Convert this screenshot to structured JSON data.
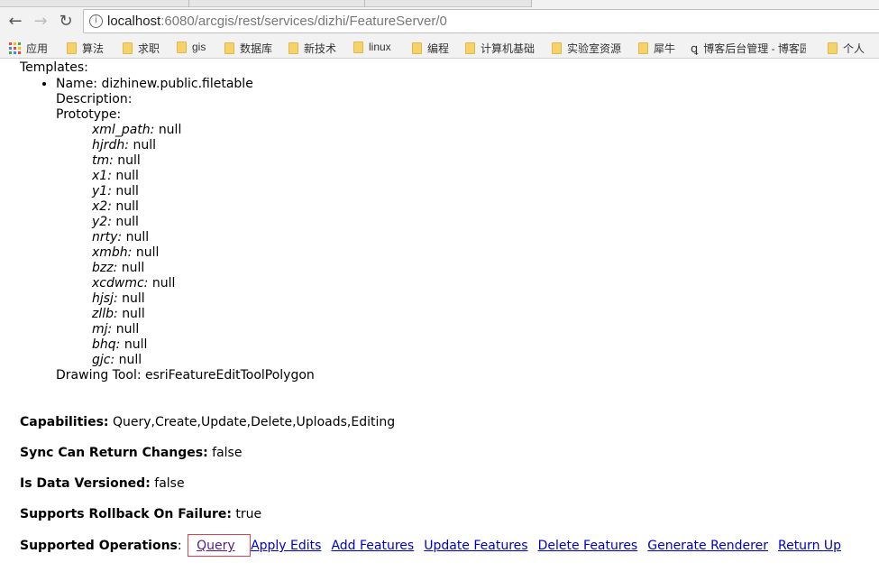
{
  "browser": {
    "url_host": "localhost",
    "url_path": ":6080/arcgis/rest/services/dizhi/FeatureServer/0",
    "bookmarks": [
      "应用",
      "算法",
      "求职",
      "gis",
      "数据库",
      "新技术",
      "linux",
      "编程",
      "计算机基础",
      "实验室资源",
      "犀牛",
      "博客后台管理 - 博客园",
      "个人"
    ]
  },
  "page": {
    "templates_label": "Templates:",
    "template": {
      "name": "Name: dizhinew.public.filetable",
      "description": "Description:",
      "prototype_label": "Prototype:",
      "fields": [
        {
          "k": "xml_path:",
          "v": "null"
        },
        {
          "k": "hjrdh:",
          "v": "null"
        },
        {
          "k": "tm:",
          "v": "null"
        },
        {
          "k": "x1:",
          "v": "null"
        },
        {
          "k": "y1:",
          "v": "null"
        },
        {
          "k": "x2:",
          "v": "null"
        },
        {
          "k": "y2:",
          "v": "null"
        },
        {
          "k": "nrty:",
          "v": "null"
        },
        {
          "k": "xmbh:",
          "v": "null"
        },
        {
          "k": "bzz:",
          "v": "null"
        },
        {
          "k": "xcdwmc:",
          "v": "null"
        },
        {
          "k": "hjsj:",
          "v": "null"
        },
        {
          "k": "zllb:",
          "v": "null"
        },
        {
          "k": "mj:",
          "v": "null"
        },
        {
          "k": "bhq:",
          "v": "null"
        },
        {
          "k": "gjc:",
          "v": "null"
        }
      ],
      "drawing_tool": "Drawing Tool: esriFeatureEditToolPolygon"
    },
    "capabilities": {
      "label": "Capabilities:",
      "value": "Query,Create,Update,Delete,Uploads,Editing"
    },
    "sync": {
      "label": "Sync Can Return Changes:",
      "value": "false"
    },
    "versioned": {
      "label": "Is Data Versioned:",
      "value": "false"
    },
    "rollback": {
      "label": "Supports Rollback On Failure:",
      "value": "true"
    },
    "operations": {
      "label": "Supported Operations",
      "colon": ":",
      "links": [
        "Query",
        "Apply Edits",
        "Add Features",
        "Update Features",
        "Delete Features",
        "Generate Renderer",
        "Return Up"
      ]
    }
  }
}
